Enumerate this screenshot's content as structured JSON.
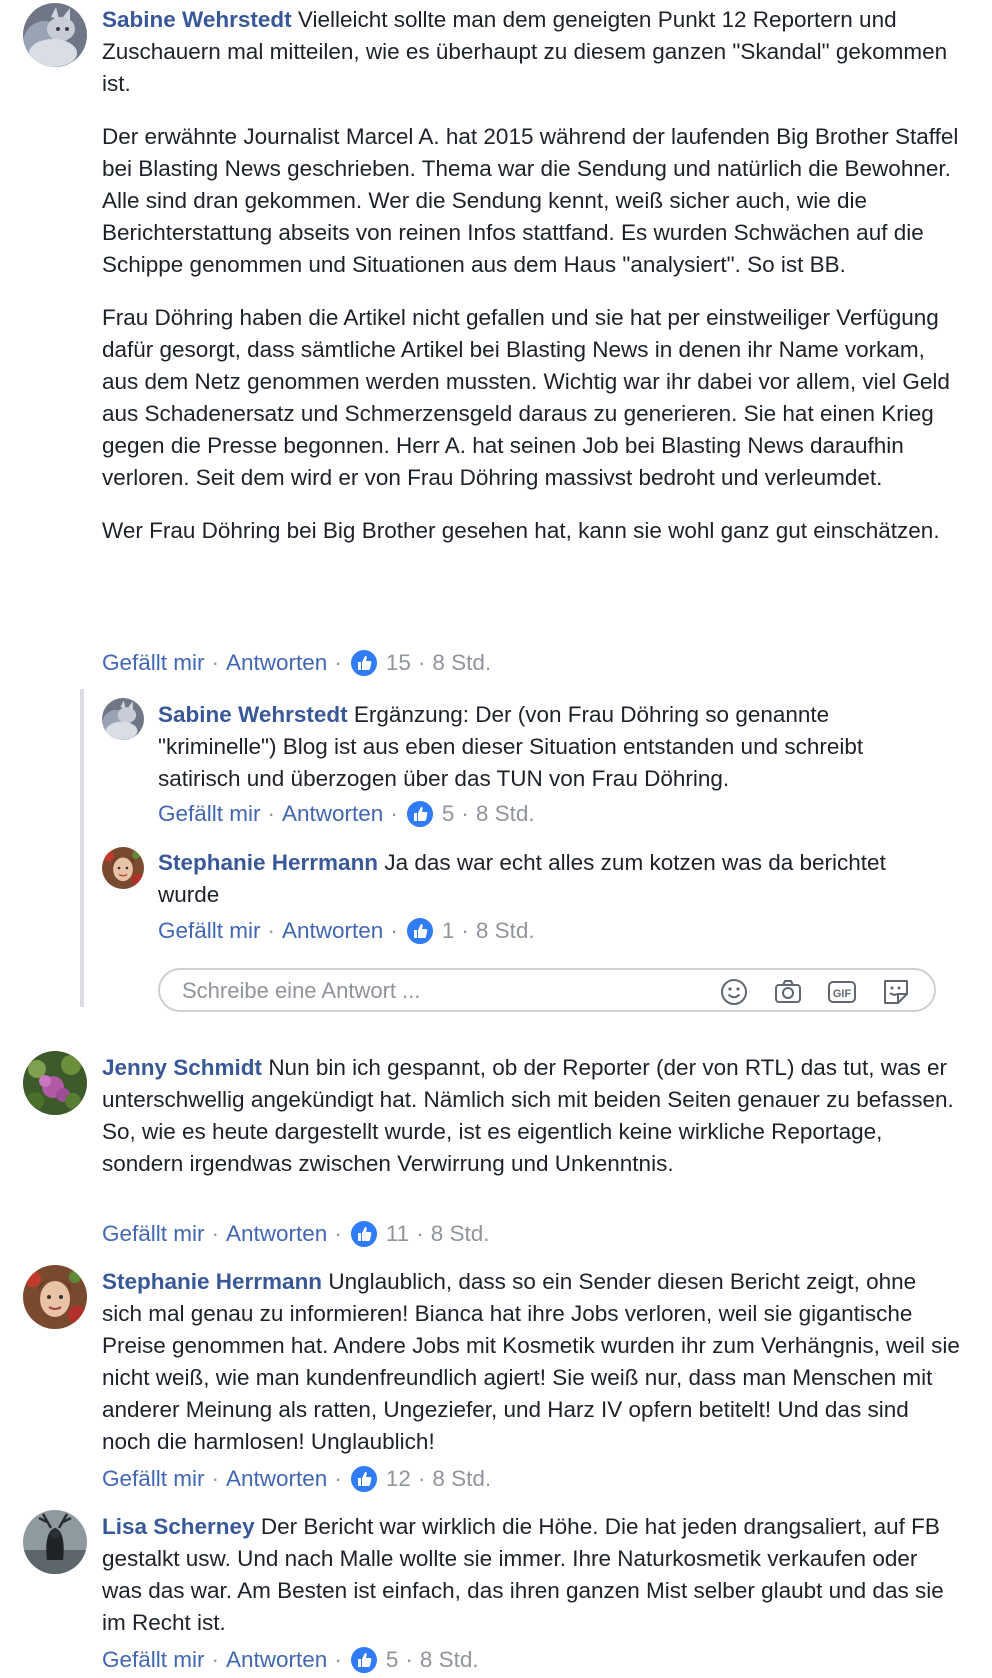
{
  "actions": {
    "like": "Gefällt mir",
    "reply": "Antworten"
  },
  "reply_box": {
    "placeholder": "Schreibe eine Antwort ..."
  },
  "comments": [
    {
      "author": "Sabine Wehrstedt",
      "paragraphs": [
        "Vielleicht sollte man dem geneigten Punkt 12 Reportern und Zuschauern mal mitteilen, wie es überhaupt zu diesem ganzen \"Skandal\" gekommen ist.",
        "Der erwähnte Journalist Marcel A. hat 2015 während der laufenden Big Brother Staffel bei Blasting News geschrieben. Thema war die Sendung und natürlich die Bewohner. Alle sind dran gekommen. Wer die Sendung kennt, weiß sicher auch, wie die Berichterstattung abseits von reinen Infos stattfand. Es wurden Schwächen auf die Schippe genommen und Situationen aus dem Haus \"analysiert\". So ist BB.",
        "Frau Döhring haben die Artikel nicht gefallen und sie hat per einstweiliger Verfügung dafür gesorgt, dass sämtliche Artikel bei Blasting News in denen ihr Name vorkam, aus dem Netz genommen werden mussten. Wichtig war ihr dabei vor allem, viel Geld aus Schadenersatz und Schmerzensgeld daraus zu generieren. Sie hat einen Krieg gegen die Presse begonnen. Herr A. hat seinen Job bei Blasting News daraufhin verloren. Seit dem wird er von Frau Döhring massivst bedroht und verleumdet.",
        "Wer Frau Döhring bei Big Brother gesehen hat, kann sie wohl ganz gut einschätzen."
      ],
      "likes": "15",
      "time": "8 Std."
    },
    {
      "author": "Sabine Wehrstedt",
      "paragraphs": [
        "Ergänzung: Der (von Frau Döhring so genannte \"kriminelle\") Blog ist aus eben dieser Situation entstanden und schreibt satirisch und überzogen über das TUN von Frau Döhring."
      ],
      "likes": "5",
      "time": "8 Std."
    },
    {
      "author": "Stephanie Herrmann",
      "paragraphs": [
        "Ja das war echt alles zum kotzen was da berichtet wurde"
      ],
      "likes": "1",
      "time": "8 Std."
    },
    {
      "author": "Jenny Schmidt",
      "paragraphs": [
        "Nun bin ich gespannt, ob der Reporter (der von RTL) das tut, was er unterschwellig angekündigt hat. Nämlich sich mit beiden Seiten genauer zu befassen. So, wie es heute dargestellt wurde, ist es eigentlich keine wirkliche Reportage, sondern irgendwas zwischen Verwirrung und Unkenntnis."
      ],
      "likes": "11",
      "time": "8 Std."
    },
    {
      "author": "Stephanie Herrmann",
      "paragraphs": [
        "Unglaublich, dass so ein Sender diesen Bericht zeigt, ohne sich mal genau zu informieren! Bianca hat ihre Jobs verloren, weil sie gigantische Preise genommen hat. Andere Jobs mit Kosmetik wurden ihr zum Verhängnis, weil sie nicht weiß, wie man kundenfreundlich agiert! Sie weiß nur, dass man Menschen mit anderer Meinung als ratten, Ungeziefer, und Harz IV opfern betitelt! Und das sind noch die harmlosen! Unglaublich!"
      ],
      "likes": "12",
      "time": "8 Std."
    },
    {
      "author": "Lisa Scherney",
      "paragraphs": [
        "Der Bericht war wirklich die Höhe. Die hat jeden drangsaliert, auf FB gestalkt usw. Und nach Malle wollte sie immer. Ihre Naturkosmetik verkaufen oder was das war. Am Besten ist einfach, das ihren ganzen Mist selber glaubt und das sie im Recht ist."
      ],
      "likes": "5",
      "time": "8 Std."
    }
  ]
}
